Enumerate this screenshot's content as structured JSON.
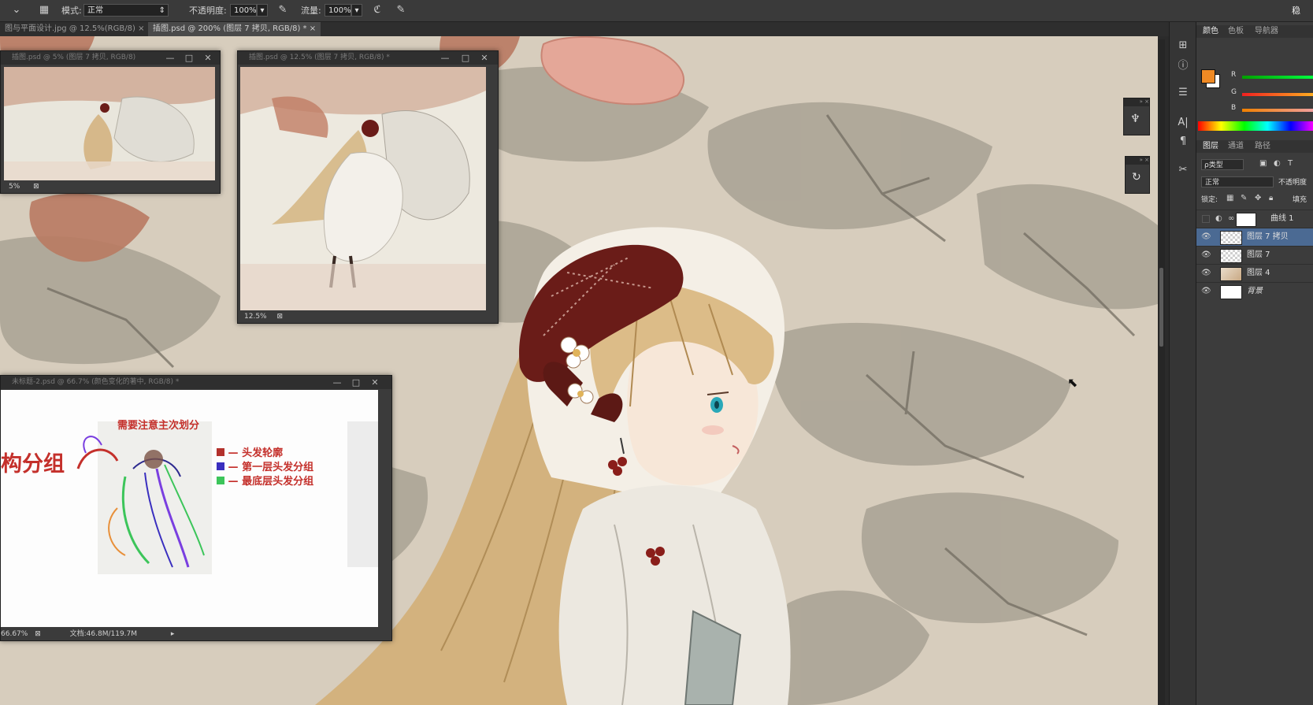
{
  "options_bar": {
    "mode_label": "模式:",
    "mode_value": "正常",
    "opacity_label": "不透明度:",
    "opacity_value": "100%",
    "flow_label": "流量:",
    "flow_value": "100%",
    "top_right_label": "稳"
  },
  "document_tabs": [
    {
      "label": "图与平面设计.jpg @ 12.5%(RGB/8)",
      "close": "×"
    },
    {
      "label": "插图.psd @ 200% (图层 7 拷贝, RGB/8) *",
      "close": "×"
    }
  ],
  "windows": {
    "nav_small": {
      "title": "插图.psd @ 5% (图层 7 拷贝, RGB/8)",
      "zoom": "5%"
    },
    "nav_large": {
      "title": "插图.psd @ 12.5% (图层 7 拷贝, RGB/8) *",
      "zoom": "12.5%"
    },
    "tutorial": {
      "title": "未标题-2.psd @ 66.7% (颜色变化的著中, RGB/8) *",
      "zoom": "66.67%",
      "doc_info": "文档:46.8M/119.7M",
      "headline": "构分组",
      "note": "需要注意主次划分",
      "legend": [
        {
          "label": "头发轮廓",
          "color": "#b3312c"
        },
        {
          "label": "第一层头发分组",
          "color": "#3a2fbf"
        },
        {
          "label": "最底层头发分组",
          "color": "#3cc55a"
        }
      ]
    }
  },
  "window_controls": {
    "minimize": "—",
    "maximize": "□",
    "close": "✕"
  },
  "panels": {
    "color_tabs": [
      "颜色",
      "色板",
      "导航器"
    ],
    "rgb_labels": [
      "R",
      "G",
      "B"
    ],
    "layer_tabs": [
      "图层",
      "通道",
      "路径"
    ],
    "filter_kind": "ρ类型",
    "blend_mode": "正常",
    "opacity_label": "不透明度",
    "lock_label": "锁定:",
    "fill_label": "填充",
    "foreground_color": "#f08a24",
    "background_color": "#ffffff",
    "layers": [
      {
        "name": "曲线 1",
        "type": "adjustment",
        "selected": false
      },
      {
        "name": "图层 7 拷贝",
        "type": "transparent",
        "selected": true
      },
      {
        "name": "图层 7",
        "type": "transparent",
        "selected": false
      },
      {
        "name": "图层 4",
        "type": "art",
        "selected": false
      },
      {
        "name": "背景",
        "type": "white",
        "selected": false
      }
    ]
  }
}
